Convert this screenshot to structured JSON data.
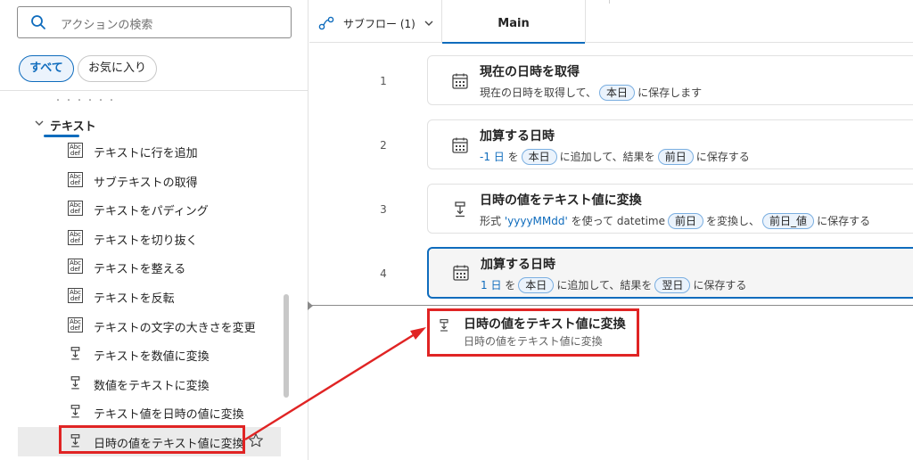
{
  "search": {
    "placeholder": "アクションの検索",
    "icon": "search-icon"
  },
  "filters": {
    "all": "すべて",
    "favorites": "お気に入り"
  },
  "scrolled_text": "・・・・・・",
  "category": {
    "label": "テキスト",
    "expanded": true
  },
  "actions": [
    {
      "label": "テキストに行を追加",
      "icon": "abc-def-icon"
    },
    {
      "label": "サブテキストの取得",
      "icon": "abc-def-icon"
    },
    {
      "label": "テキストをパディング",
      "icon": "abc-def-icon"
    },
    {
      "label": "テキストを切り抜く",
      "icon": "abc-def-icon"
    },
    {
      "label": "テキストを整える",
      "icon": "abc-def-icon"
    },
    {
      "label": "テキストを反転",
      "icon": "abc-def-icon"
    },
    {
      "label": "テキストの文字の大きさを変更",
      "icon": "abc-def-icon"
    },
    {
      "label": "テキストを数値に変換",
      "icon": "convert-icon"
    },
    {
      "label": "数値をテキストに変換",
      "icon": "convert-icon"
    },
    {
      "label": "テキスト値を日時の値に変換",
      "icon": "convert-icon"
    },
    {
      "label": "日時の値をテキスト値に変換",
      "icon": "convert-icon",
      "selected": true
    }
  ],
  "designer": {
    "subflow_label": "サブフロー (1)",
    "main_tab": "Main",
    "steps": [
      {
        "num": "1",
        "title": "現在の日時を取得",
        "icon": "calendar-icon",
        "pre": "現在の日時を取得して、",
        "var1": "本日",
        "post": "に保存します"
      },
      {
        "num": "2",
        "title": "加算する日時",
        "icon": "calendar-icon",
        "val": "-1 日",
        "a": "を",
        "var1": "本日",
        "b": "に追加して、結果を",
        "var2": "前日",
        "c": "に保存する"
      },
      {
        "num": "3",
        "title": "日時の値をテキスト値に変換",
        "icon": "convert-icon",
        "a": "形式",
        "fmt": "'yyyyMMdd'",
        "b": "を使って datetime",
        "var1": "前日",
        "c": "を変換し、",
        "var2": "前日_値",
        "d": "に保存する"
      },
      {
        "num": "4",
        "title": "加算する日時",
        "icon": "calendar-icon",
        "selected": true,
        "val": "1 日",
        "a": "を",
        "var1": "本日",
        "b": "に追加して、結果を",
        "var2": "翌日",
        "c": "に保存する"
      }
    ],
    "drag_ghost": {
      "title": "日時の値をテキスト値に変換",
      "subtitle": "日時の値をテキスト値に変換"
    }
  },
  "colors": {
    "accent": "#0f6cbd",
    "annotation_red": "#e02424"
  }
}
